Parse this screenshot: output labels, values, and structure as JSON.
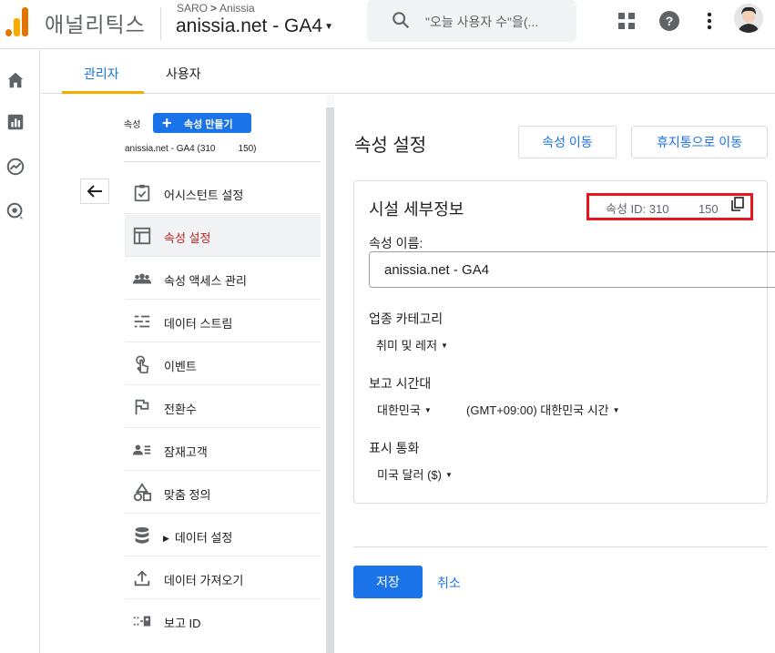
{
  "app": {
    "name": "애널리틱스",
    "breadcrumb": {
      "account": "SARO",
      "property": "Anissia"
    },
    "property_selector": "anissia.net - GA4",
    "search_placeholder": "\"오늘 사용자 수\"을(..."
  },
  "tabs": [
    {
      "label": "관리자",
      "active": true
    },
    {
      "label": "사용자",
      "active": false
    }
  ],
  "nav": {
    "property_label": "속성",
    "create_button": "속성 만들기",
    "selected_property": "anissia.net - GA4 (310         150)",
    "items": [
      {
        "label": "어시스턴트 설정",
        "icon": "checklist-icon"
      },
      {
        "label": "속성 설정",
        "icon": "property-settings-icon",
        "selected": true
      },
      {
        "label": "속성 액세스 관리",
        "icon": "people-icon"
      },
      {
        "label": "데이터 스트림",
        "icon": "data-stream-icon"
      },
      {
        "label": "이벤트",
        "icon": "touch-icon"
      },
      {
        "label": "전환수",
        "icon": "flag-icon"
      },
      {
        "label": "잠재고객",
        "icon": "audience-icon"
      },
      {
        "label": "맞춤 정의",
        "icon": "shapes-icon"
      },
      {
        "label": "데이터 설정",
        "icon": "database-icon",
        "expandable": true
      },
      {
        "label": "데이터 가져오기",
        "icon": "upload-icon"
      },
      {
        "label": "보고 ID",
        "icon": "reporting-id-icon"
      }
    ]
  },
  "main": {
    "title": "속성 설정",
    "move_button": "속성 이동",
    "trash_button": "휴지통으로 이동",
    "card_title": "시설 세부정보",
    "property_id": "속성 ID: 310         150",
    "name_label": "속성 이름:",
    "name_value": "anissia.net - GA4",
    "industry_label": "업종 카테고리",
    "industry_value": "취미 및 레저",
    "timezone_label": "보고 시간대",
    "timezone_country": "대한민국",
    "timezone_value": "(GMT+09:00) 대한민국 시간",
    "currency_label": "표시 통화",
    "currency_value": "미국 달러 ($)",
    "save_button": "저장",
    "cancel_button": "취소"
  },
  "colors": {
    "accent": "#1a73e8",
    "highlight_box": "#e8141e",
    "selected_text": "#c5221f",
    "logo_orange": "#f9ab00",
    "logo_dark_orange": "#e37400"
  }
}
